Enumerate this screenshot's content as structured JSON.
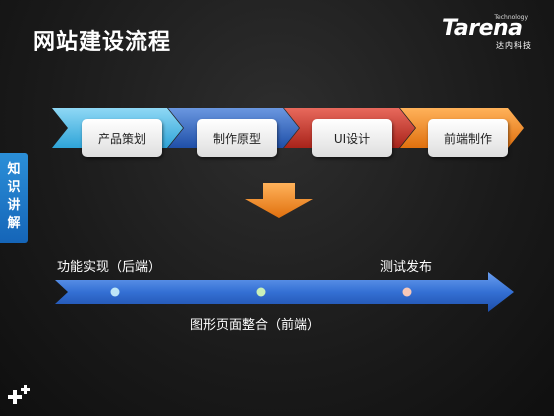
{
  "slide": {
    "title": "网站建设流程",
    "logo": {
      "main": "Tarena",
      "small": "Technology",
      "sub": "达内科技"
    },
    "side_tab": "知识讲解"
  },
  "steps": [
    {
      "label": "产品策划",
      "color": "#5ec0e8"
    },
    {
      "label": "制作原型",
      "color": "#3a6fc7"
    },
    {
      "label": "UI设计",
      "color": "#c93a2e"
    },
    {
      "label": "前端制作",
      "color": "#f08a22"
    }
  ],
  "timeline": {
    "labels_above": [
      "功能实现（后端）",
      "测试发布"
    ],
    "label_below": "图形页面整合（前端）",
    "dot_colors": [
      "#bfe6f7",
      "#c9f0b8",
      "#f7c8b8"
    ]
  },
  "colors": {
    "arrow_down": "#f08a22",
    "timeline_arrow": "#2f6fd0",
    "side_tab": "#1e78c8"
  }
}
